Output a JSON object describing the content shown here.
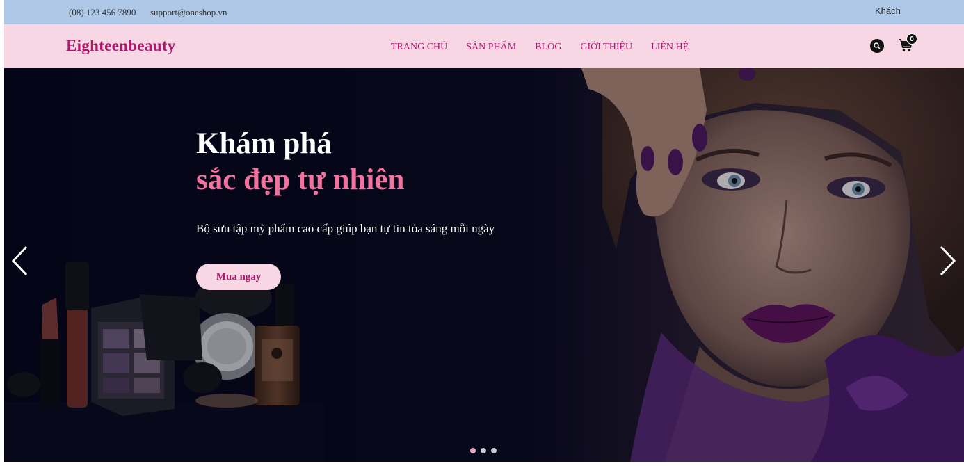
{
  "topbar": {
    "phone": "(08) 123 456 7890",
    "email": "support@oneshop.vn",
    "user": "Khách"
  },
  "header": {
    "logo": "Eighteenbeauty",
    "nav": [
      "TRANG CHỦ",
      "SẢN PHẨM",
      "BLOG",
      "GIỚI THIỆU",
      "LIÊN HỆ"
    ],
    "search_icon": "search-icon",
    "cart_icon": "cart-icon",
    "cart_count": "0"
  },
  "hero": {
    "title_line1": "Khám phá",
    "title_line2": "sắc đẹp tự nhiên",
    "subtitle": "Bộ sưu tập mỹ phẩm cao cấp giúp bạn tự tin tỏa sáng mỗi ngày",
    "cta_label": "Mua ngay",
    "prev_icon": "chevron-left-icon",
    "next_icon": "chevron-right-icon",
    "slide_count": 3,
    "active_slide": 1
  },
  "colors": {
    "topbar_bg": "#b0c8e8",
    "navbar_bg": "#f7d7e3",
    "brand": "#b0176e",
    "accent_pink": "#f0729e",
    "hero_bg": "#07081a"
  }
}
